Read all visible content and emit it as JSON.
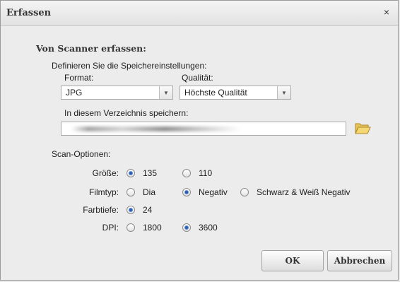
{
  "dialog": {
    "title": "Erfassen",
    "close_symbol": "×"
  },
  "section": {
    "title": "Von Scanner erfassen:",
    "storage_label": "Definieren Sie die Speichereinstellungen:"
  },
  "format": {
    "label": "Format:",
    "value": "JPG"
  },
  "quality": {
    "label": "Qualität:",
    "value": "Höchste Qualität"
  },
  "directory": {
    "label": "In diesem Verzeichnis speichern:",
    "value": ""
  },
  "scan_options": {
    "title": "Scan-Optionen:",
    "size": {
      "label": "Größe:",
      "options": [
        "135",
        "110"
      ],
      "selected": "135"
    },
    "film_type": {
      "label": "Filmtyp:",
      "options": [
        "Dia",
        "Negativ",
        "Schwarz & Weiß Negativ"
      ],
      "selected": "Negativ"
    },
    "color_depth": {
      "label": "Farbtiefe:",
      "options": [
        "24"
      ],
      "selected": "24"
    },
    "dpi": {
      "label": "DPI:",
      "options": [
        "1800",
        "3600"
      ],
      "selected": "3600"
    }
  },
  "buttons": {
    "ok": "OK",
    "cancel": "Abbrechen"
  },
  "icons": {
    "close": "close-icon",
    "folder": "folder-open-icon",
    "dropdown": "chevron-down-icon"
  }
}
